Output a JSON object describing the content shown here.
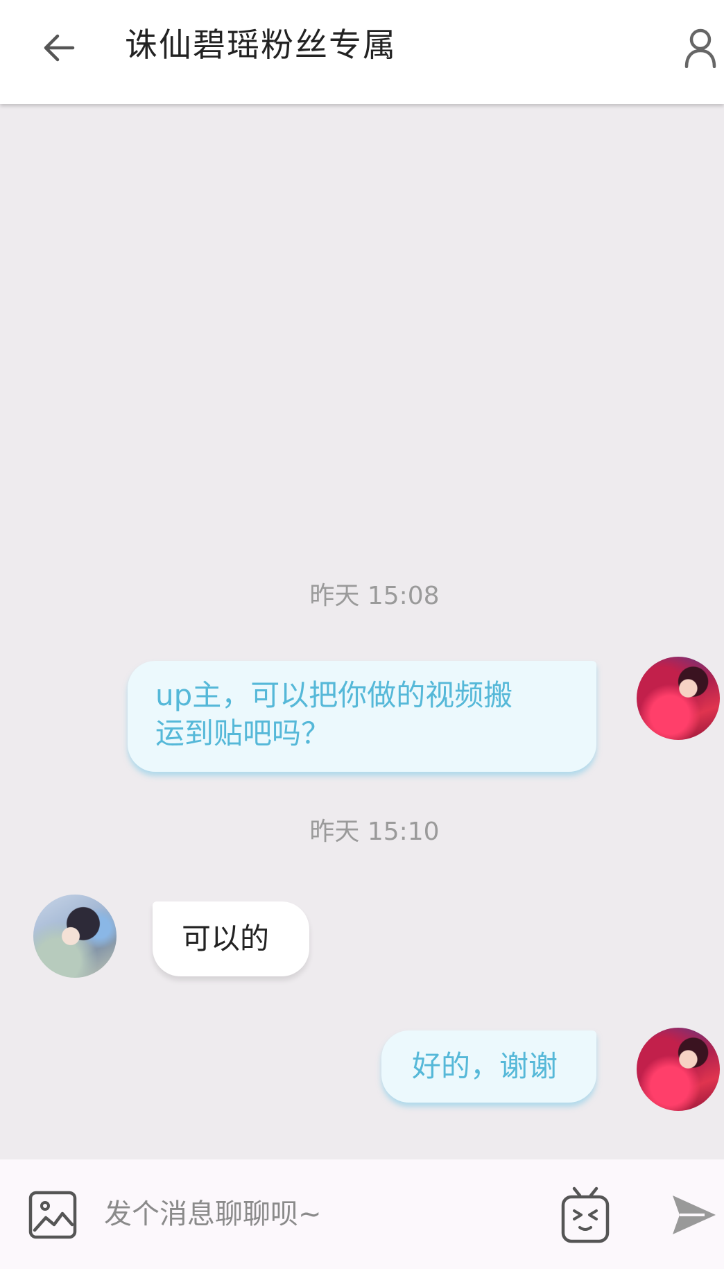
{
  "header": {
    "title": "诛仙碧瑶粉丝专属",
    "back_icon": "arrow-left-icon",
    "profile_icon": "person-icon"
  },
  "messages": [
    {
      "type": "time",
      "text": "昨天 15:08"
    },
    {
      "type": "outgoing",
      "text": "up主，可以把你做的视频搬运到贴吧吗？",
      "line1": "up主，可以把你做的视频搬",
      "line2": "运到贴吧吗？"
    },
    {
      "type": "time",
      "text": "昨天 15:10"
    },
    {
      "type": "incoming",
      "text": "可以的"
    },
    {
      "type": "outgoing",
      "text": "好的，谢谢"
    }
  ],
  "input": {
    "placeholder": "发个消息聊聊呗~",
    "value": "",
    "image_icon": "image-icon",
    "emoji_icon": "bilibili-emoji-icon",
    "send_icon": "send-icon"
  },
  "colors": {
    "header_bg": "#ffffff",
    "chat_bg": "#eeebee",
    "outgoing_bubble": "#ecf9fd",
    "outgoing_text": "#55b8d8",
    "incoming_bubble": "#ffffff",
    "timestamp": "#9a9a9a"
  }
}
